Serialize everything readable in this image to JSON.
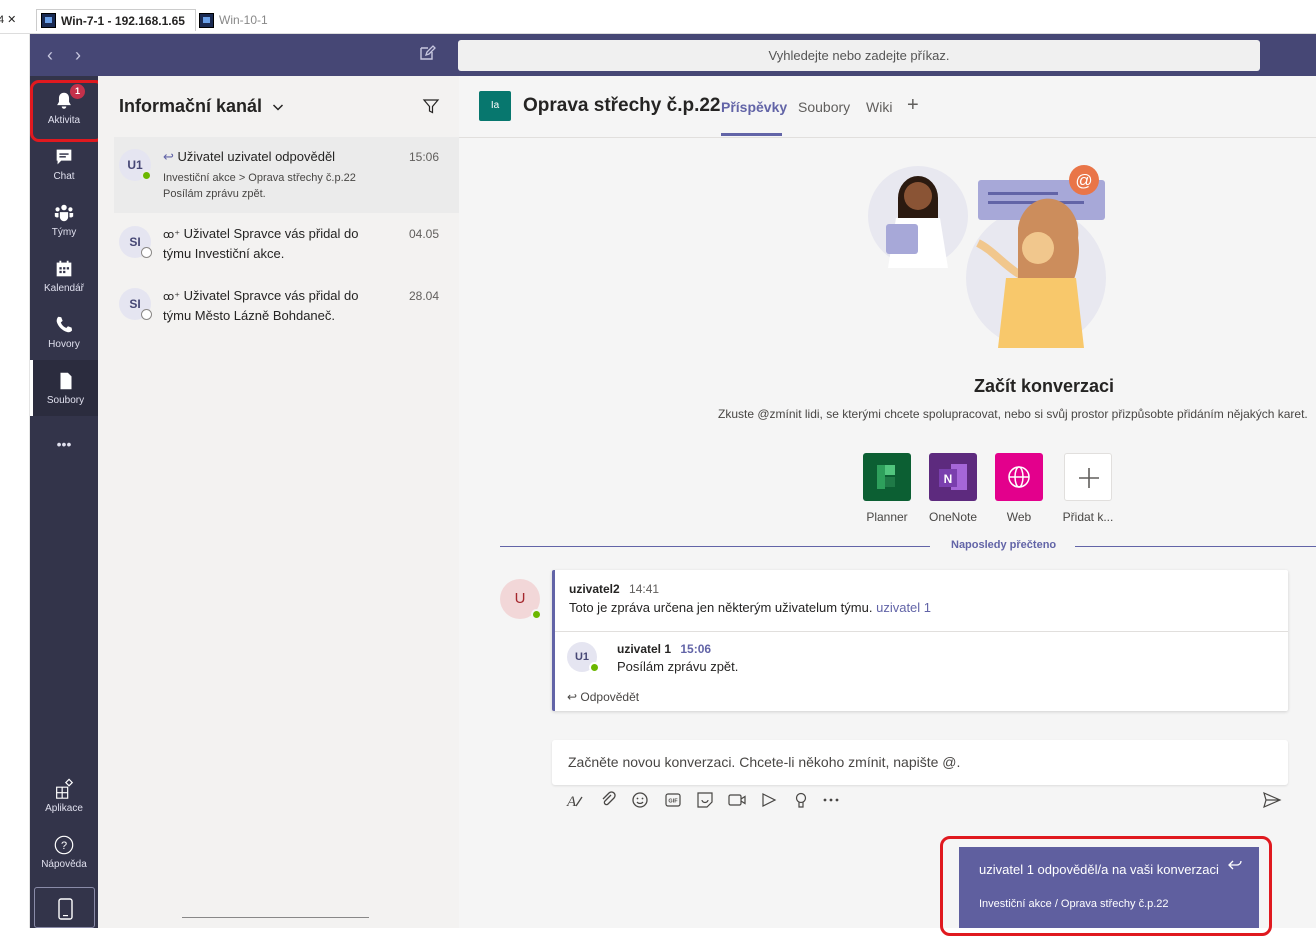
{
  "rdp": {
    "tab_left_label": "4 ✕",
    "tab1_label": "Win-7-1 - 192.168.1.65",
    "tab2_label": "Win-10-1"
  },
  "search": {
    "placeholder": "Vyhledejte nebo zadejte příkaz."
  },
  "rail": {
    "activity": "Aktivita",
    "activity_badge": "1",
    "chat": "Chat",
    "teams": "Týmy",
    "calendar": "Kalendář",
    "calls": "Hovory",
    "files": "Soubory",
    "more": "•••",
    "apps": "Aplikace",
    "help": "Nápověda"
  },
  "feed": {
    "title": "Informační kanál",
    "items": [
      {
        "avatar": "U1",
        "title": "Uživatel uzivatel odpověděl",
        "line1": "Investiční akce > Oprava střechy č.p.22",
        "line2": "Posílám zprávu zpět.",
        "time": "15:06"
      },
      {
        "avatar": "SI",
        "title": "Uživatel Spravce vás přidal do",
        "line1": "týmu Investiční akce.",
        "time": "04.05"
      },
      {
        "avatar": "SI",
        "title": "Uživatel Spravce vás přidal do",
        "line1": "týmu Město Lázně Bohdaneč.",
        "time": "28.04"
      }
    ]
  },
  "channel": {
    "avatar": "Ia",
    "name": "Oprava střechy č.p.22",
    "tabs": [
      "Příspěvky",
      "Soubory",
      "Wiki"
    ],
    "add_tab": "+"
  },
  "start": {
    "title": "Začít konverzaci",
    "description": "Zkuste @zmínit lidi, se kterými chcete spolupracovat, nebo si svůj prostor přizpůsobte přidáním nějakých karet.",
    "apps": [
      "Planner",
      "OneNote",
      "Web",
      "Přidat k..."
    ]
  },
  "last_read": "Naposledy přečteno",
  "post": {
    "avatar": "U",
    "author": "uzivatel2",
    "time": "14:41",
    "text": "Toto je zpráva určena jen některým uživatelum týmu.",
    "mention": "uzivatel 1",
    "reply": {
      "avatar": "U1",
      "author": "uzivatel 1",
      "time": "15:06",
      "text": "Posílám zprávu zpět."
    },
    "reply_action": "Odpovědět"
  },
  "compose": {
    "placeholder": "Začněte novou konverzaci. Chcete-li někoho zmínit, napište @."
  },
  "toast": {
    "title": "uzivatel 1 odpověděl/a na vaši konverzaci",
    "subtitle": "Investiční akce / Oprava střechy č.p.22"
  },
  "colors": {
    "teams_purple": "#464775",
    "rail": "#33344a",
    "accent": "#6264a7",
    "highlight_red": "#e0191f"
  }
}
